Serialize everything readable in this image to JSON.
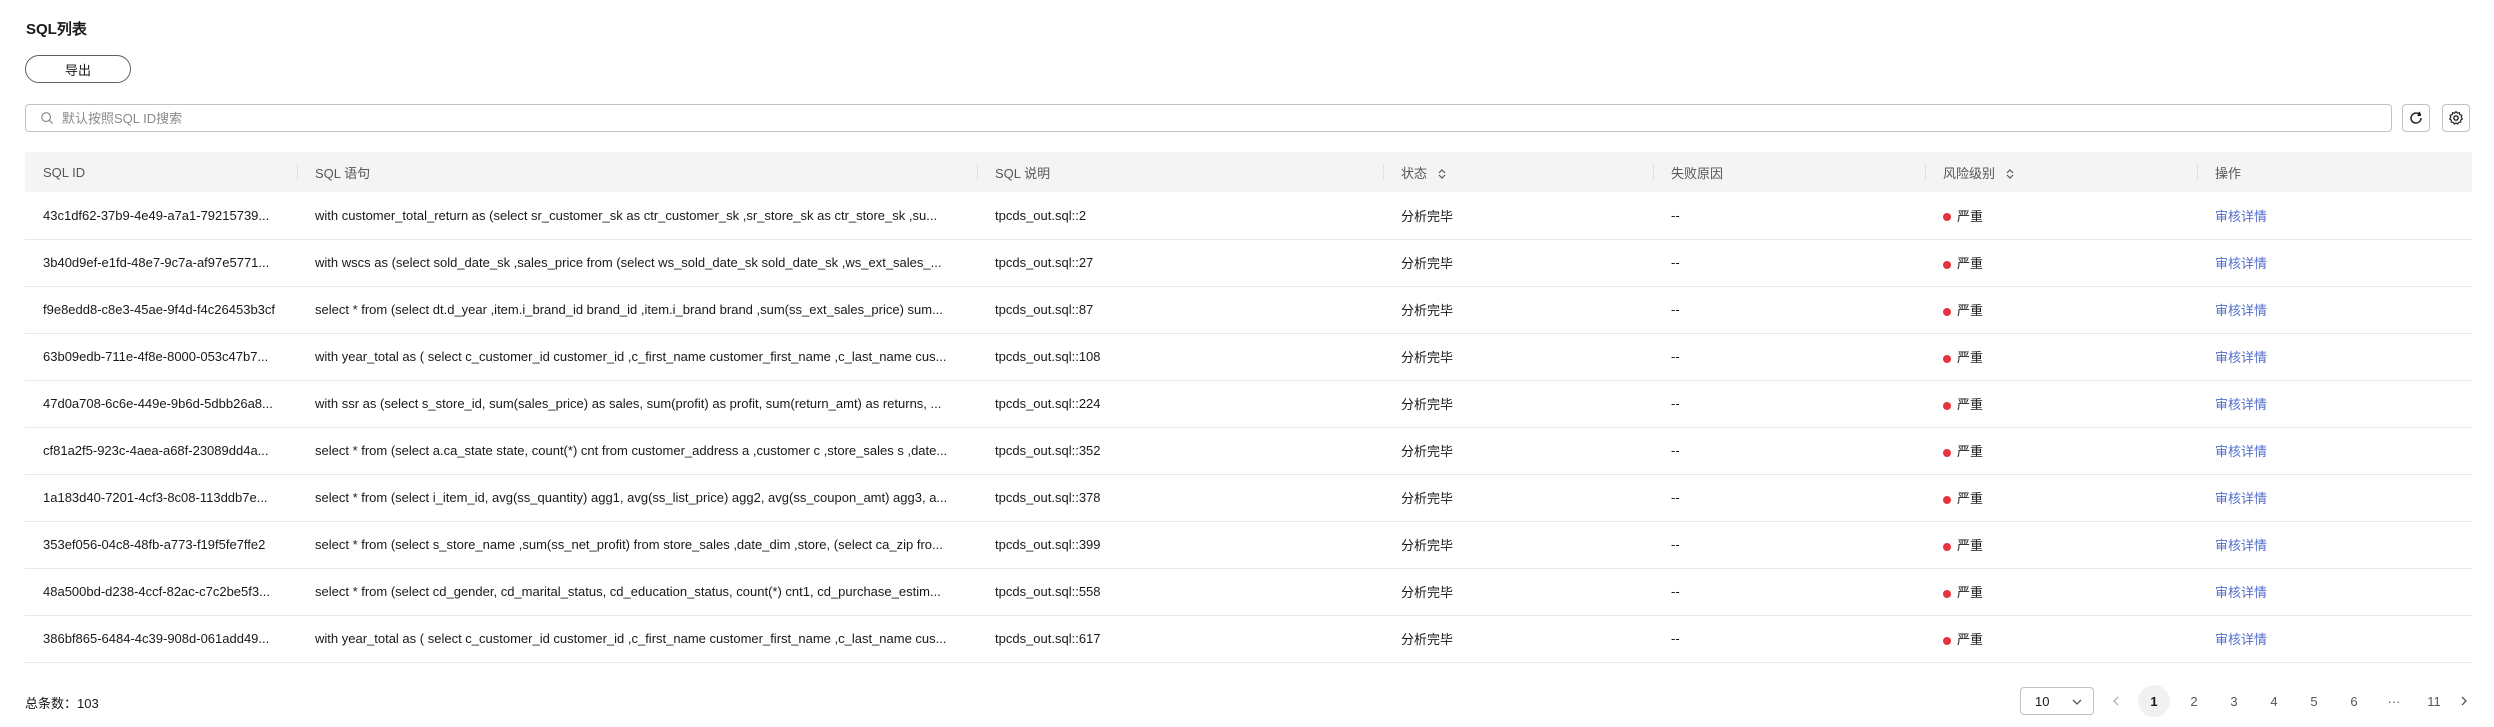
{
  "page": {
    "title": "SQL列表",
    "export_label": "导出",
    "search_placeholder": "默认按照SQL ID搜索"
  },
  "table": {
    "headers": {
      "sql_id": "SQL ID",
      "sql_stmt": "SQL 语句",
      "sql_desc": "SQL 说明",
      "status": "状态",
      "fail_reason": "失败原因",
      "risk": "风险级别",
      "action": "操作"
    },
    "risk_color": "#e6333f",
    "rows": [
      {
        "id": "43c1df62-37b9-4e49-a7a1-79215739...",
        "stmt": "with customer_total_return as (select sr_customer_sk as ctr_customer_sk ,sr_store_sk as ctr_store_sk ,su...",
        "desc": "tpcds_out.sql::2",
        "status": "分析完毕",
        "reason": "--",
        "risk": "严重",
        "action": "审核详情"
      },
      {
        "id": "3b40d9ef-e1fd-48e7-9c7a-af97e5771...",
        "stmt": "with wscs as (select sold_date_sk ,sales_price from (select ws_sold_date_sk sold_date_sk ,ws_ext_sales_...",
        "desc": "tpcds_out.sql::27",
        "status": "分析完毕",
        "reason": "--",
        "risk": "严重",
        "action": "审核详情"
      },
      {
        "id": "f9e8edd8-c8e3-45ae-9f4d-f4c26453b3cf",
        "stmt": "select * from (select dt.d_year ,item.i_brand_id brand_id ,item.i_brand brand ,sum(ss_ext_sales_price) sum...",
        "desc": "tpcds_out.sql::87",
        "status": "分析完毕",
        "reason": "--",
        "risk": "严重",
        "action": "审核详情"
      },
      {
        "id": "63b09edb-711e-4f8e-8000-053c47b7...",
        "stmt": "with year_total as ( select c_customer_id customer_id ,c_first_name customer_first_name ,c_last_name cus...",
        "desc": "tpcds_out.sql::108",
        "status": "分析完毕",
        "reason": "--",
        "risk": "严重",
        "action": "审核详情"
      },
      {
        "id": "47d0a708-6c6e-449e-9b6d-5dbb26a8...",
        "stmt": "with ssr as (select s_store_id, sum(sales_price) as sales, sum(profit) as profit, sum(return_amt) as returns, ...",
        "desc": "tpcds_out.sql::224",
        "status": "分析完毕",
        "reason": "--",
        "risk": "严重",
        "action": "审核详情"
      },
      {
        "id": "cf81a2f5-923c-4aea-a68f-23089dd4a...",
        "stmt": "select * from (select a.ca_state state, count(*) cnt from customer_address a ,customer c ,store_sales s ,date...",
        "desc": "tpcds_out.sql::352",
        "status": "分析完毕",
        "reason": "--",
        "risk": "严重",
        "action": "审核详情"
      },
      {
        "id": "1a183d40-7201-4cf3-8c08-113ddb7e...",
        "stmt": "select * from (select i_item_id, avg(ss_quantity) agg1, avg(ss_list_price) agg2, avg(ss_coupon_amt) agg3, a...",
        "desc": "tpcds_out.sql::378",
        "status": "分析完毕",
        "reason": "--",
        "risk": "严重",
        "action": "审核详情"
      },
      {
        "id": "353ef056-04c8-48fb-a773-f19f5fe7ffe2",
        "stmt": "select * from (select s_store_name ,sum(ss_net_profit) from store_sales ,date_dim ,store, (select ca_zip fro...",
        "desc": "tpcds_out.sql::399",
        "status": "分析完毕",
        "reason": "--",
        "risk": "严重",
        "action": "审核详情"
      },
      {
        "id": "48a500bd-d238-4ccf-82ac-c7c2be5f3...",
        "stmt": "select * from (select cd_gender, cd_marital_status, cd_education_status, count(*) cnt1, cd_purchase_estim...",
        "desc": "tpcds_out.sql::558",
        "status": "分析完毕",
        "reason": "--",
        "risk": "严重",
        "action": "审核详情"
      },
      {
        "id": "386bf865-6484-4c39-908d-061add49...",
        "stmt": "with year_total as ( select c_customer_id customer_id ,c_first_name customer_first_name ,c_last_name cus...",
        "desc": "tpcds_out.sql::617",
        "status": "分析完毕",
        "reason": "--",
        "risk": "严重",
        "action": "审核详情"
      }
    ]
  },
  "footer": {
    "total_label": "总条数：103",
    "page_size": "10",
    "pages": [
      "1",
      "2",
      "3",
      "4",
      "5",
      "6",
      "···",
      "11"
    ],
    "current_page": "1"
  }
}
